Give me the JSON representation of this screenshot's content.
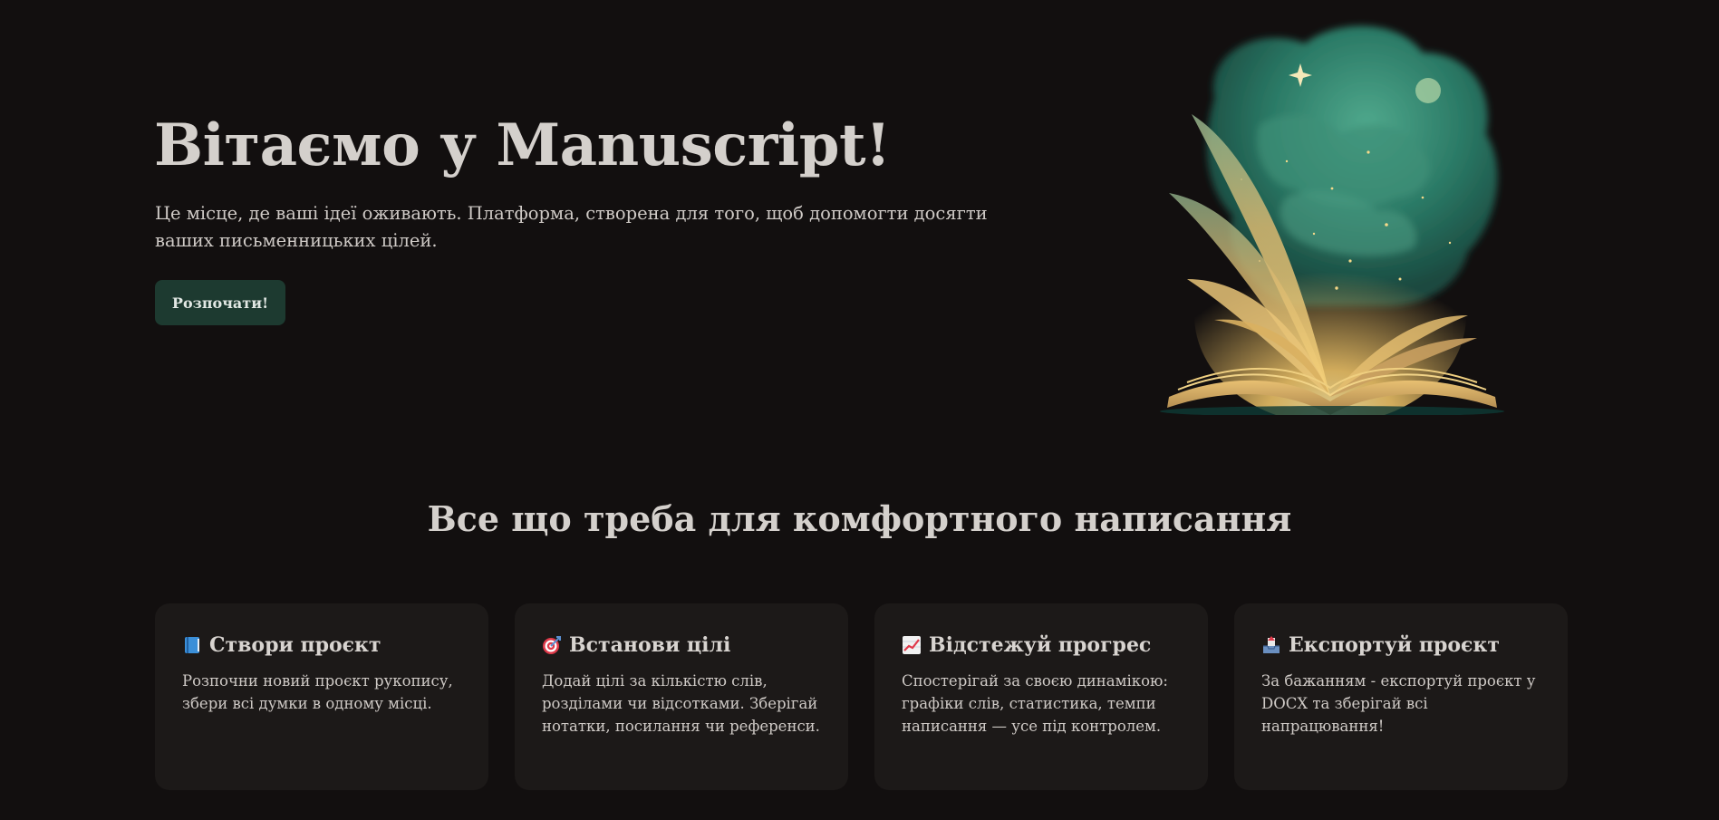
{
  "hero": {
    "title": "Вітаємо у Manuscript!",
    "description": "Це місце, де ваші ідеї оживають. Платформа, створена для того, щоб допомогти досягти ваших письменницьких цілей.",
    "cta_label": "Розпочати!"
  },
  "features": {
    "title": "Все що треба для комфортного написання",
    "cards": [
      {
        "icon": "blue-book-icon",
        "title": "Створи проєкт",
        "description": "Розпочни новий проєкт рукопису, збери всі думки в одному місці."
      },
      {
        "icon": "target-icon",
        "title": "Встанови цілі",
        "description": "Додай цілі за кількістю слів, розділами чи відсотками. Зберігай нотатки, посилання чи референси."
      },
      {
        "icon": "chart-increasing-icon",
        "title": "Відстежуй прогрес",
        "description": "Спостерігай за своєю динамікою: графіки слів, статистика, темпи написання — усе під контролем."
      },
      {
        "icon": "outbox-tray-icon",
        "title": "Експортуй проєкт",
        "description": "За бажанням - експортуй проєкт у DOCX та зберігай всі напрацювання!"
      }
    ]
  },
  "colors": {
    "background": "#120f0f",
    "card_background": "#1c1918",
    "button_background": "#1d3a30",
    "text": "#d4d0cc"
  }
}
